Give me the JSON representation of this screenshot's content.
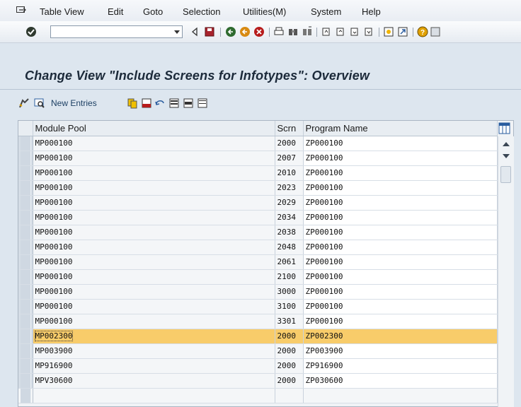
{
  "menubar": {
    "items": [
      {
        "label": "Table View"
      },
      {
        "label": "Edit"
      },
      {
        "label": "Goto"
      },
      {
        "label": "Selection"
      },
      {
        "label": "Utilities(M)"
      },
      {
        "label": "System"
      },
      {
        "label": "Help"
      }
    ]
  },
  "toolbar": {
    "command_field_value": ""
  },
  "page": {
    "title": "Change View \"Include Screens for Infotypes\": Overview"
  },
  "app_toolbar": {
    "new_entries_label": "New Entries"
  },
  "table": {
    "columns": [
      "Module Pool",
      "Scrn",
      "Program Name"
    ],
    "rows": [
      {
        "module_pool": "MP000100",
        "scrn": "2000",
        "program": "ZP000100"
      },
      {
        "module_pool": "MP000100",
        "scrn": "2007",
        "program": "ZP000100"
      },
      {
        "module_pool": "MP000100",
        "scrn": "2010",
        "program": "ZP000100"
      },
      {
        "module_pool": "MP000100",
        "scrn": "2023",
        "program": "ZP000100"
      },
      {
        "module_pool": "MP000100",
        "scrn": "2029",
        "program": "ZP000100"
      },
      {
        "module_pool": "MP000100",
        "scrn": "2034",
        "program": "ZP000100"
      },
      {
        "module_pool": "MP000100",
        "scrn": "2038",
        "program": "ZP000100"
      },
      {
        "module_pool": "MP000100",
        "scrn": "2048",
        "program": "ZP000100"
      },
      {
        "module_pool": "MP000100",
        "scrn": "2061",
        "program": "ZP000100"
      },
      {
        "module_pool": "MP000100",
        "scrn": "2100",
        "program": "ZP000100"
      },
      {
        "module_pool": "MP000100",
        "scrn": "3000",
        "program": "ZP000100"
      },
      {
        "module_pool": "MP000100",
        "scrn": "3100",
        "program": "ZP000100"
      },
      {
        "module_pool": "MP000100",
        "scrn": "3301",
        "program": "ZP000100"
      },
      {
        "module_pool": "MP002300",
        "scrn": "2000",
        "program": "ZP002300"
      },
      {
        "module_pool": "MP003900",
        "scrn": "2000",
        "program": "ZP003900"
      },
      {
        "module_pool": "MP916900",
        "scrn": "2000",
        "program": "ZP916900"
      },
      {
        "module_pool": "MPV30600",
        "scrn": "2000",
        "program": "ZP030600"
      }
    ],
    "highlighted_row_index": 13
  },
  "colors": {
    "highlight": "#f8cc6a",
    "title_band": "#dde6ef"
  }
}
